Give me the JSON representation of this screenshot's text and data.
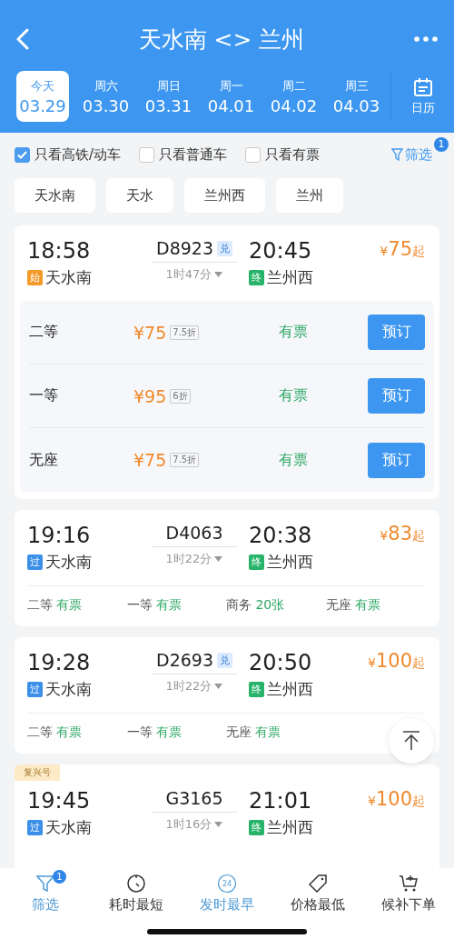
{
  "header": {
    "title": "天水南 <> 兰州"
  },
  "dates": [
    {
      "weekday": "今天",
      "date": "03.29",
      "selected": true
    },
    {
      "weekday": "周六",
      "date": "03.30",
      "selected": false
    },
    {
      "weekday": "周日",
      "date": "03.31",
      "selected": false
    },
    {
      "weekday": "周一",
      "date": "04.01",
      "selected": false
    },
    {
      "weekday": "周二",
      "date": "04.02",
      "selected": false
    },
    {
      "weekday": "周三",
      "date": "04.03",
      "selected": false
    }
  ],
  "calendar_label": "日历",
  "filters": [
    {
      "label": "只看高铁/动车",
      "checked": true
    },
    {
      "label": "只看普通车",
      "checked": false
    },
    {
      "label": "只看有票",
      "checked": false
    }
  ],
  "filter_button": {
    "label": "筛选",
    "badge": "1"
  },
  "station_chips": [
    "天水南",
    "天水",
    "兰州西",
    "兰州"
  ],
  "trains": [
    {
      "depart_time": "18:58",
      "train_no": "D8923",
      "redeem_badge": "兑",
      "arrive_time": "20:45",
      "price": {
        "currency": "¥",
        "amount": "75",
        "suffix": "起"
      },
      "from": {
        "tag": "始",
        "kind": "start",
        "station": "天水南"
      },
      "duration": "1时47分",
      "to": {
        "tag": "终",
        "kind": "end",
        "station": "兰州西"
      },
      "expanded": true,
      "seats": [
        {
          "class": "二等",
          "price": "¥75",
          "discount": "7.5折",
          "status": "有票",
          "button": "预订"
        },
        {
          "class": "一等",
          "price": "¥95",
          "discount": "6折",
          "status": "有票",
          "button": "预订"
        },
        {
          "class": "无座",
          "price": "¥75",
          "discount": "7.5折",
          "status": "有票",
          "button": "预订"
        }
      ]
    },
    {
      "depart_time": "19:16",
      "train_no": "D4063",
      "arrive_time": "20:38",
      "price": {
        "currency": "¥",
        "amount": "83",
        "suffix": "起"
      },
      "from": {
        "tag": "过",
        "kind": "pass",
        "station": "天水南"
      },
      "duration": "1时22分",
      "to": {
        "tag": "终",
        "kind": "end",
        "station": "兰州西"
      },
      "expanded": false,
      "seats": [
        {
          "class": "二等",
          "status": "有票"
        },
        {
          "class": "一等",
          "status": "有票"
        },
        {
          "class": "商务",
          "status": "20张"
        },
        {
          "class": "无座",
          "status": "有票"
        }
      ]
    },
    {
      "depart_time": "19:28",
      "train_no": "D2693",
      "redeem_badge": "兑",
      "arrive_time": "20:50",
      "price": {
        "currency": "¥",
        "amount": "100",
        "suffix": "起"
      },
      "from": {
        "tag": "过",
        "kind": "pass",
        "station": "天水南"
      },
      "duration": "1时22分",
      "to": {
        "tag": "终",
        "kind": "end",
        "station": "兰州西"
      },
      "expanded": false,
      "seats": [
        {
          "class": "二等",
          "status": "有票"
        },
        {
          "class": "一等",
          "status": "有票"
        },
        {
          "class": "无座",
          "status": "有票"
        }
      ]
    },
    {
      "label_tag": "复兴号",
      "depart_time": "19:45",
      "train_no": "G3165",
      "arrive_time": "21:01",
      "price": {
        "currency": "¥",
        "amount": "100",
        "suffix": "起"
      },
      "from": {
        "tag": "过",
        "kind": "pass",
        "station": "天水南"
      },
      "duration": "1时16分",
      "to": {
        "tag": "终",
        "kind": "end",
        "station": "兰州西"
      },
      "expanded": false
    }
  ],
  "bottom_bar": [
    {
      "label": "筛选",
      "kind": "filter",
      "selected": true,
      "badge": "1"
    },
    {
      "label": "耗时最短",
      "kind": "timer",
      "selected": false
    },
    {
      "label": "发时最早",
      "kind": "clock24",
      "icon_text": "24",
      "selected": true
    },
    {
      "label": "价格最低",
      "kind": "tag",
      "selected": false
    },
    {
      "label": "候补下单",
      "kind": "cart",
      "selected": false
    }
  ]
}
